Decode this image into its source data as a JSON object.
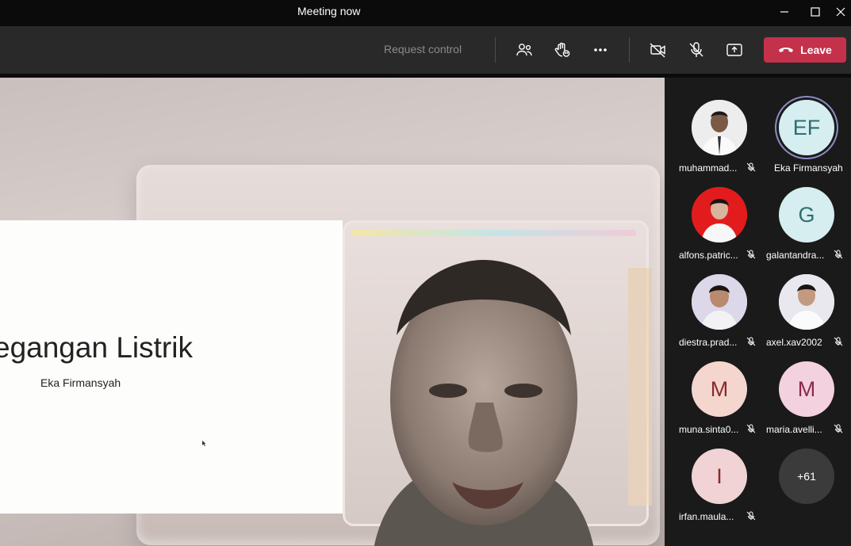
{
  "window": {
    "title": "Meeting now"
  },
  "toolbar": {
    "request_control": "Request control",
    "leave_label": "Leave",
    "icons": [
      "people-icon",
      "raise-hand-icon",
      "more-options-icon",
      "camera-off-icon",
      "mic-off-icon",
      "share-tray-icon",
      "phone-hangup-icon"
    ]
  },
  "slide": {
    "title": "egangan Listrik",
    "subtitle": "Eka Firmansyah"
  },
  "participants": [
    {
      "name": "muhammad...",
      "initials": "",
      "avatar_bg": "#e9e9e9",
      "photo": true,
      "muted": true
    },
    {
      "name": "Eka Firmansyah",
      "initials": "EF",
      "avatar_bg": "#d6eef0",
      "photo": false,
      "muted": false,
      "speaking": true
    },
    {
      "name": "alfons.patric...",
      "initials": "",
      "avatar_bg": "#e21c1c",
      "photo": true,
      "muted": true
    },
    {
      "name": "galantandra...",
      "initials": "G",
      "avatar_bg": "#d6eef0",
      "photo": false,
      "muted": true
    },
    {
      "name": "diestra.prad...",
      "initials": "",
      "avatar_bg": "#d9d4ea",
      "photo": true,
      "muted": true
    },
    {
      "name": "axel.xav2002",
      "initials": "",
      "avatar_bg": "#e6e6ee",
      "photo": true,
      "muted": true
    },
    {
      "name": "muna.sinta0...",
      "initials": "M",
      "avatar_bg": "#f4d6cf",
      "photo": false,
      "muted": true
    },
    {
      "name": "maria.avelli...",
      "initials": "M",
      "avatar_bg": "#f3d1de",
      "photo": false,
      "muted": true
    },
    {
      "name": "irfan.maula...",
      "initials": "I",
      "avatar_bg": "#f1d3d5",
      "photo": false,
      "muted": true
    },
    {
      "name": "",
      "initials": "+61",
      "avatar_bg": "#3b3b3b",
      "photo": false,
      "muted": false
    }
  ],
  "colors": {
    "leave": "#c4314b",
    "toolbar": "#292929",
    "panel": "#1a1a1a",
    "initials_teal": "#2c6e70",
    "initials_rose": "#8a2a2a"
  }
}
